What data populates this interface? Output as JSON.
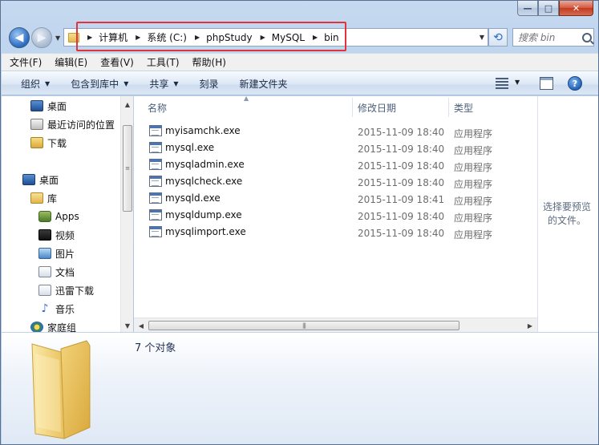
{
  "window": {
    "minimize_glyph": "—",
    "maximize_glyph": "□",
    "close_glyph": "✕"
  },
  "address": {
    "crumbs": [
      "计算机",
      "系统 (C:)",
      "phpStudy",
      "MySQL",
      "bin"
    ],
    "highlight_color": "#e0343a"
  },
  "search": {
    "placeholder": "搜索 bin"
  },
  "menu": [
    "文件(F)",
    "编辑(E)",
    "查看(V)",
    "工具(T)",
    "帮助(H)"
  ],
  "toolbar": {
    "organize": "组织",
    "include_in_library": "包含到库中",
    "share": "共享",
    "burn": "刻录",
    "new_folder": "新建文件夹"
  },
  "navpane": {
    "items": [
      {
        "label": "桌面",
        "icon": "desktop-icon"
      },
      {
        "label": "最近访问的位置",
        "icon": "recent-places-icon"
      },
      {
        "label": "下载",
        "icon": "downloads-icon"
      },
      {
        "label": "桌面",
        "icon": "desktop-icon"
      },
      {
        "label": "库",
        "icon": "libraries-icon"
      },
      {
        "label": "Apps",
        "icon": "apps-icon"
      },
      {
        "label": "视频",
        "icon": "video-icon"
      },
      {
        "label": "图片",
        "icon": "pictures-icon"
      },
      {
        "label": "文档",
        "icon": "documents-icon"
      },
      {
        "label": "迅雷下载",
        "icon": "xunlei-icon"
      },
      {
        "label": "音乐",
        "icon": "music-icon"
      },
      {
        "label": "家庭组",
        "icon": "homegroup-icon"
      }
    ]
  },
  "columns": {
    "name": "名称",
    "date": "修改日期",
    "type": "类型"
  },
  "files": [
    {
      "name": "myisamchk.exe",
      "date": "2015-11-09 18:40",
      "type": "应用程序"
    },
    {
      "name": "mysql.exe",
      "date": "2015-11-09 18:40",
      "type": "应用程序"
    },
    {
      "name": "mysqladmin.exe",
      "date": "2015-11-09 18:40",
      "type": "应用程序"
    },
    {
      "name": "mysqlcheck.exe",
      "date": "2015-11-09 18:40",
      "type": "应用程序"
    },
    {
      "name": "mysqld.exe",
      "date": "2015-11-09 18:41",
      "type": "应用程序"
    },
    {
      "name": "mysqldump.exe",
      "date": "2015-11-09 18:40",
      "type": "应用程序"
    },
    {
      "name": "mysqlimport.exe",
      "date": "2015-11-09 18:40",
      "type": "应用程序"
    }
  ],
  "preview": {
    "line1": "选择要预览",
    "line2": "的文件。"
  },
  "details": {
    "count": "7 个对象"
  }
}
